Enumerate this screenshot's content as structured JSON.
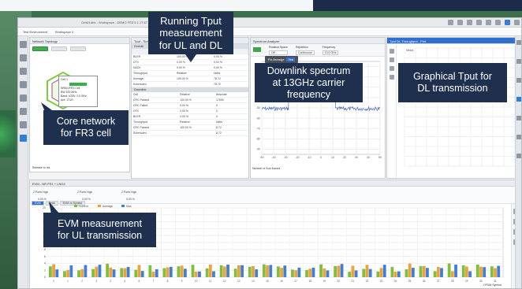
{
  "window": {
    "title": "Orbit/Labs - Workspace - DEMO FR3 5.1.17.67",
    "menu_items": [
      "Test Environment",
      "Workspace 2"
    ],
    "right_items": [
      "Start",
      "Stop",
      "Reset",
      "Analytics",
      "Home",
      "Close",
      "Open Testbench",
      "UE Demo",
      "CB"
    ]
  },
  "network_panel": {
    "title": "Network Topology",
    "button_label": "Live Mode",
    "node_label": "Cell 1",
    "lines": [
      "NR5G/FR3 Cell",
      "BW 100 MHz",
      "Band: n255 / 13 GHz",
      "Ant: 1T1R",
      "DL/UL"
    ],
    "footer": "Release to ms"
  },
  "results_panel": {
    "title": "Tput - Summary",
    "section_overall": "Overall",
    "section_dl": "Downlink",
    "overall_cols": [
      "",
      "Downlink",
      "UL Cell 1"
    ],
    "overall_rows": [
      [
        "BLER",
        "100.00 %",
        "0.00 %"
      ],
      [
        "DTX",
        "0.00 %",
        "0.00 %"
      ],
      [
        "NACK",
        "0.00 %",
        "0.00 %"
      ],
      [
        "Throughput",
        "Relative",
        "kbit/s"
      ],
      [
        "Average",
        "100.00 %",
        "78.72"
      ],
      [
        "Scheduled",
        "-",
        "78.72"
      ]
    ],
    "dl_rows": [
      [
        "Cell",
        "Relative",
        "Absolute"
      ],
      [
        "CRC Passed",
        "100.00 %",
        "17500"
      ],
      [
        "CRC Failed",
        "0.00 %",
        "0"
      ],
      [
        "DTX",
        "0.00 %",
        "0"
      ],
      [
        "BLER",
        "0.00 %",
        "0"
      ],
      [
        "Throughput",
        "Relative",
        "kbit/s"
      ],
      [
        "CRC Passed",
        "100.00 %",
        "8.72"
      ],
      [
        "Scheduled",
        "-",
        "8.72"
      ]
    ]
  },
  "spectrum_panel": {
    "title": "Spectrum Analyzer",
    "tooltip": "Fix Arrange",
    "tooltip_btn": "Yes",
    "ctrl_labels": [
      "Rotation Space",
      "Repetition",
      "Frequency"
    ],
    "ctrl_values": [
      "Off",
      "Continuous",
      "13.0 GHz"
    ],
    "axis_bottom_label": "Number of Sub-frames",
    "x_ticks": [
      "-50",
      "-40",
      "-30",
      "-20",
      "-10",
      "0",
      "10",
      "20",
      "30",
      "40",
      "50"
    ],
    "y_ticks": [
      "-10",
      "-20",
      "-30",
      "-40",
      "-50",
      "-60",
      "-70",
      "-80",
      "-90"
    ]
  },
  "dl_panel": {
    "title": "Tput DL Throughput - Plot",
    "y_label": "Mbit/s"
  },
  "evm_panel": {
    "title": "EVM - NR FR1 + LNG4",
    "cfg_labels": [
      "2 Ports High",
      "2 Ports High",
      "2 Ports High"
    ],
    "cfg_values": [
      "0.00 %",
      "0.00 %",
      "0.00 %"
    ],
    "tabs": [
      "EVM",
      "Peak",
      "EVM vs Symbol"
    ],
    "legend": [
      "Current",
      "Average",
      "Max"
    ],
    "x_label": "OFDM Symbol",
    "y_ticks": [
      "20",
      "18",
      "16",
      "14",
      "12",
      "10",
      "8",
      "6",
      "4",
      "2",
      "0"
    ]
  },
  "annotations": {
    "running_tput": [
      "Running Tput",
      "measurement",
      "for UL and DL"
    ],
    "downlink_spectrum": [
      "Downlink spectrum",
      "at 13GHz carrier",
      "frequency"
    ],
    "graphical_tput": [
      "Graphical Tput for",
      "DL transmission"
    ],
    "core_network": [
      "Core network",
      "for FR3 cell"
    ],
    "evm_measurement": [
      "EVM measurement",
      "for UL transmission"
    ]
  },
  "colors": {
    "callout": "#1f2f4e",
    "accent_blue": "#2f6fcf",
    "bar_green": "#7fbf3f",
    "bar_orange": "#f0a23a",
    "bar_blue": "#3f7fd8",
    "spectrum": "#3a56b0"
  }
}
